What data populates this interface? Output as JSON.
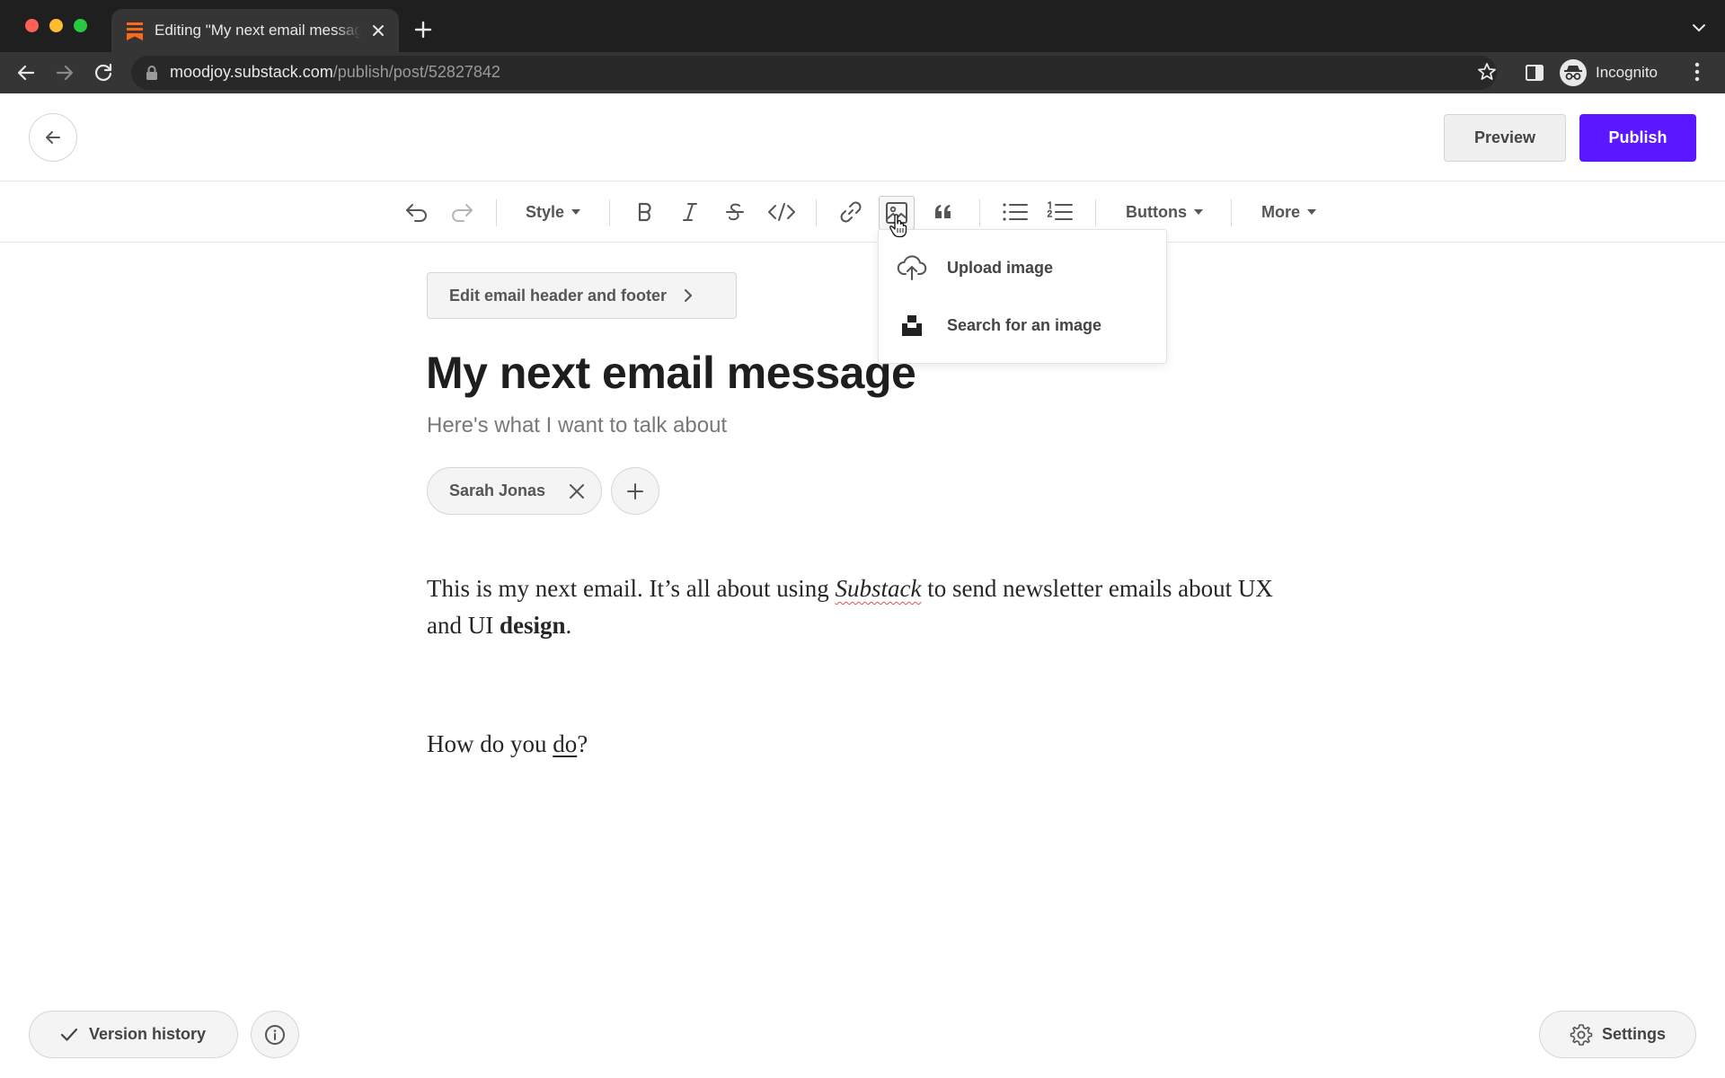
{
  "browser": {
    "tab_title": "Editing \"My next email message\"",
    "url_host": "moodjoy.substack.com",
    "url_path": "/publish/post/52827842",
    "profile_label": "Incognito"
  },
  "header": {
    "preview_label": "Preview",
    "publish_label": "Publish"
  },
  "toolbar": {
    "style_label": "Style",
    "buttons_label": "Buttons",
    "more_label": "More"
  },
  "image_menu": {
    "upload_label": "Upload image",
    "search_label": "Search for an image"
  },
  "post": {
    "edit_header_footer_label": "Edit email header and footer",
    "title": "My next email message",
    "subtitle": "Here's what I want to talk about",
    "author": "Sarah Jonas",
    "paragraph1": {
      "before": "This is my next email. It’s all about using ",
      "italic": "Substack",
      "middle": " to send newsletter emails about UX and UI ",
      "bold": "design",
      "after": "."
    },
    "paragraph2": {
      "before": "How do you ",
      "underlined": "do",
      "after": "?"
    }
  },
  "footer": {
    "version_history_label": "Version history",
    "settings_label": "Settings"
  },
  "colors": {
    "publish_accent": "#5b17ff",
    "browser_frame": "#1f1f1f",
    "favicon": "#ff6719"
  }
}
